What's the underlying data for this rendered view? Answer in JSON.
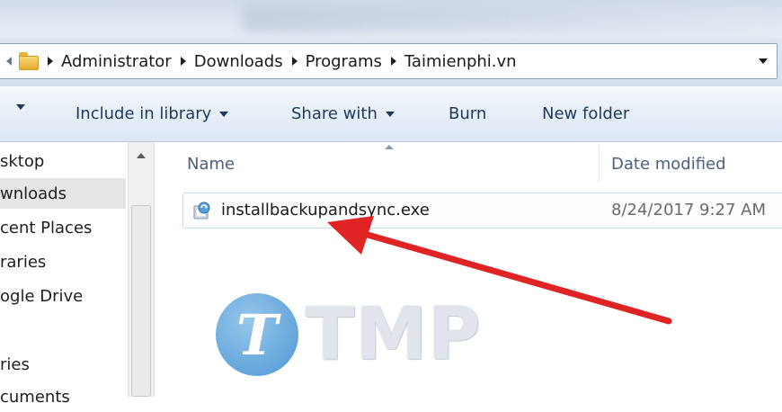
{
  "address_bar": {
    "breadcrumbs": [
      "Administrator",
      "Downloads",
      "Programs",
      "Taimienphi.vn"
    ]
  },
  "toolbar": {
    "include_in_library": "Include in library",
    "share_with": "Share with",
    "burn": "Burn",
    "new_folder": "New folder"
  },
  "nav_pane": {
    "items": [
      {
        "label": "sktop"
      },
      {
        "label": "wnloads",
        "selected": true
      },
      {
        "label": "cent Places"
      },
      {
        "label": "raries"
      },
      {
        "label": "ogle Drive"
      },
      {
        "label": ""
      },
      {
        "label": "ries"
      },
      {
        "label": "cuments"
      }
    ]
  },
  "file_list": {
    "columns": {
      "name": "Name",
      "date_modified": "Date modified"
    },
    "rows": [
      {
        "name": "installbackupandsync.exe",
        "date_modified": "8/24/2017 9:27 AM",
        "icon": "installer-icon"
      }
    ]
  },
  "annotation": {
    "arrow_color": "#e02424"
  },
  "watermark": {
    "text": "TMP",
    "logo_letter": "T"
  },
  "colors": {
    "toolbar_text": "#1e395b",
    "selection_border": "#c6dcf2",
    "arrow": "#e02424"
  }
}
